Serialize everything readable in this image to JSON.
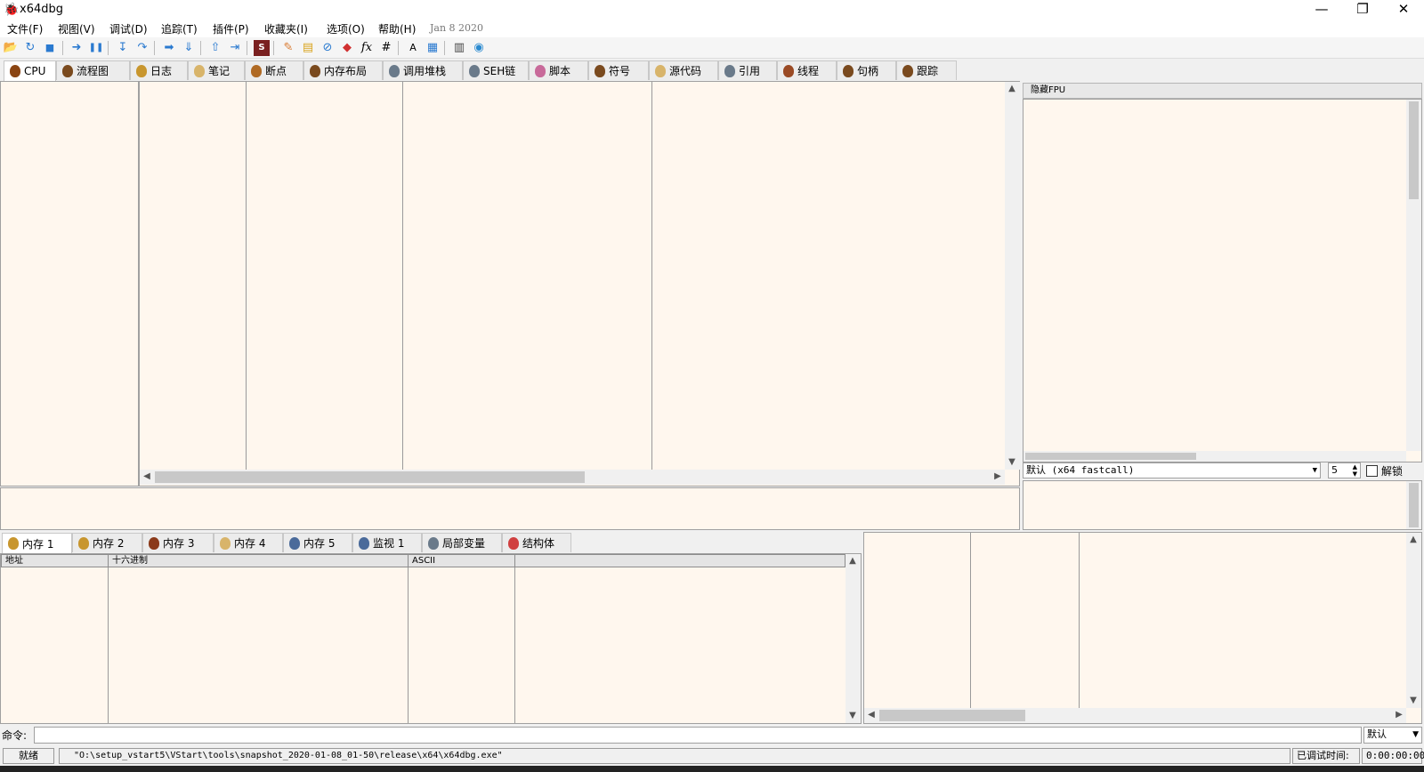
{
  "window": {
    "title": "x64dbg",
    "controls": [
      "—",
      "❐",
      "✕"
    ]
  },
  "menu": {
    "items": [
      "文件(F)",
      "视图(V)",
      "调试(D)",
      "追踪(T)",
      "插件(P)",
      "收藏夹(I)",
      "选项(O)",
      "帮助(H)"
    ],
    "build_date": "Jan 8 2020"
  },
  "toolbar": {
    "icons": [
      "open-folder-icon",
      "restart-icon",
      "stop-icon",
      "run-icon",
      "pause-icon",
      "step-into-icon",
      "step-over-icon",
      "trace-into-icon",
      "trace-over-icon",
      "execute-till-return-icon",
      "run-to-user-code-icon",
      "scylla-icon",
      "patch-icon",
      "comments-icon",
      "labels-icon",
      "bookmarks-icon",
      "functions-icon",
      "variables-icon",
      "strings-icon",
      "calculator-icon",
      "memory-icon",
      "cheatsheet-icon"
    ],
    "glyphs": [
      "📂",
      "↻",
      "■",
      "➜",
      "❚❚",
      "↧",
      "↷",
      "➡",
      "⇓",
      "⇧",
      "⇥",
      "S",
      "✎",
      "▤",
      "⊘",
      "◆",
      "fx",
      "#",
      "A",
      "▦",
      "▥",
      "◉"
    ]
  },
  "main_tabs": [
    {
      "label": "CPU",
      "icon_color": "#8b4513",
      "active": true
    },
    {
      "label": "流程图",
      "icon_color": "#7a4a1e"
    },
    {
      "label": "日志",
      "icon_color": "#c8962e"
    },
    {
      "label": "笔记",
      "icon_color": "#d8b46a"
    },
    {
      "label": "断点",
      "icon_color": "#b06a24"
    },
    {
      "label": "内存布局",
      "icon_color": "#7a4a1e"
    },
    {
      "label": "调用堆栈",
      "icon_color": "#6a7a8a"
    },
    {
      "label": "SEH链",
      "icon_color": "#6a7a8a"
    },
    {
      "label": "脚本",
      "icon_color": "#c86a9a"
    },
    {
      "label": "符号",
      "icon_color": "#7a4a1e"
    },
    {
      "label": "源代码",
      "icon_color": "#d8b46a"
    },
    {
      "label": "引用",
      "icon_color": "#6a7a8a"
    },
    {
      "label": "线程",
      "icon_color": "#9a4a24"
    },
    {
      "label": "句柄",
      "icon_color": "#7a4a1e"
    },
    {
      "label": "跟踪",
      "icon_color": "#7a4a1e"
    }
  ],
  "registers": {
    "header": "隐藏FPU",
    "calling_convention": "默认 (x64 fastcall)",
    "arg_count": "5",
    "unlock_label": "解锁"
  },
  "dump_tabs": [
    {
      "label": "内存 1",
      "icon_color": "#c8962e",
      "active": true
    },
    {
      "label": "内存 2",
      "icon_color": "#c8962e"
    },
    {
      "label": "内存 3",
      "icon_color": "#8b3a1a"
    },
    {
      "label": "内存 4",
      "icon_color": "#d8b46a"
    },
    {
      "label": "内存 5",
      "icon_color": "#4a6a9a"
    },
    {
      "label": "监视 1",
      "icon_color": "#4a6a9a"
    },
    {
      "label": "局部变量",
      "icon_color": "#6a7a8a"
    },
    {
      "label": "结构体",
      "icon_color": "#d04040"
    }
  ],
  "dump_columns": [
    "地址",
    "十六进制",
    "ASCII",
    ""
  ],
  "command": {
    "label": "命令:",
    "value": "",
    "mode": "默认"
  },
  "status": {
    "state": "就绪",
    "message": "\"O:\\setup_vstart5\\VStart\\tools\\snapshot_2020-01-08_01-50\\release\\x64\\x64dbg.exe\"",
    "debug_time_label": "已调试时间:",
    "debug_time": "0:00:00:00"
  }
}
